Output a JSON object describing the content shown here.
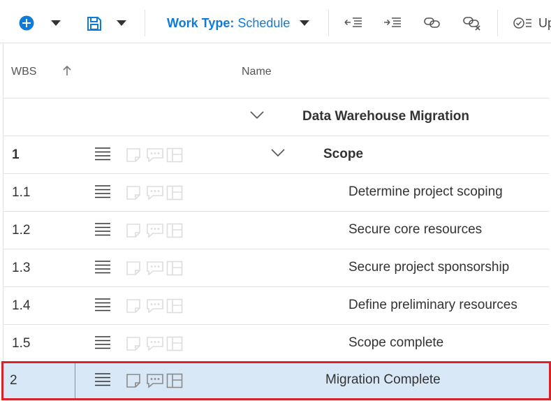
{
  "toolbar": {
    "add_icon": "add-circle-icon",
    "save_icon": "save-icon",
    "work_type_label": "Work Type:",
    "work_type_value": "Schedule",
    "outdent_icon": "outdent-icon",
    "indent_icon": "indent-icon",
    "link_icon": "link-icon",
    "unlink_icon": "unlink-icon",
    "update_icon": "checklist-icon",
    "update_label": "Up",
    "accent_color": "#0f7ad8"
  },
  "grid": {
    "columns": {
      "wbs": "WBS",
      "name": "Name"
    },
    "rows": [
      {
        "wbs": "",
        "name": "Data Warehouse Migration",
        "bold": true,
        "expanded": true,
        "level": 0,
        "summary": true
      },
      {
        "wbs": "1",
        "name": "Scope",
        "bold": true,
        "expanded": true,
        "level": 1
      },
      {
        "wbs": "1.1",
        "name": "Determine project scoping",
        "bold": false,
        "level": 2
      },
      {
        "wbs": "1.2",
        "name": "Secure core resources",
        "bold": false,
        "level": 2
      },
      {
        "wbs": "1.3",
        "name": "Secure project sponsorship",
        "bold": false,
        "level": 2
      },
      {
        "wbs": "1.4",
        "name": "Define preliminary resources",
        "bold": false,
        "level": 2
      },
      {
        "wbs": "1.5",
        "name": "Scope complete",
        "bold": false,
        "level": 2
      },
      {
        "wbs": "2",
        "name": "Migration Complete",
        "bold": false,
        "level": 1,
        "selected": true
      }
    ],
    "selection_color": "#d8e8f6",
    "highlight_border_color": "#d9232a"
  }
}
